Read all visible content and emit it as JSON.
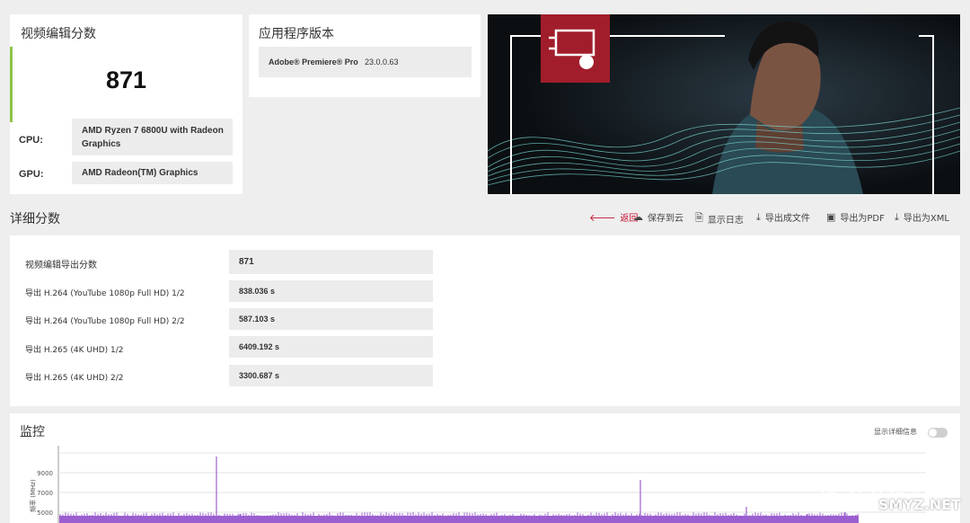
{
  "score_card": {
    "title": "视频编辑分数",
    "score": "871",
    "cpu_label": "CPU:",
    "cpu_value": "AMD Ryzen 7 6800U with Radeon Graphics",
    "gpu_label": "GPU:",
    "gpu_value": "AMD Radeon(TM) Graphics"
  },
  "version_card": {
    "title": "应用程序版本",
    "app_name": "Adobe® Premiere® Pro",
    "app_version": "23.0.0.63"
  },
  "details": {
    "title": "详细分数",
    "toolbar": {
      "back": "返回",
      "save_cloud": "保存到云",
      "show_log": "显示日志",
      "export_file": "导出成文件",
      "export_pdf": "导出为PDF",
      "export_xml": "导出为XML"
    },
    "rows": [
      {
        "label": "视频编辑导出分数",
        "value": "871"
      },
      {
        "label": "导出 H.264 (YouTube 1080p Full HD) 1/2",
        "value": "838.036 s"
      },
      {
        "label": "导出 H.264 (YouTube 1080p Full HD) 2/2",
        "value": "587.103 s"
      },
      {
        "label": "导出 H.265 (4K UHD) 1/2",
        "value": "6409.192 s"
      },
      {
        "label": "导出 H.265 (4K UHD) 2/2",
        "value": "3300.687 s"
      }
    ]
  },
  "monitor": {
    "title": "监控",
    "show_details_label": "显示详细信息",
    "y_axis_label": "频率 (MHz)",
    "y_ticks": [
      "9000",
      "7000",
      "5000"
    ]
  },
  "watermark": {
    "text": "值 什么值得买",
    "site": "SMYZ.NET"
  },
  "colors": {
    "accent_green": "#8ec449",
    "brand_red": "#a11d2b",
    "chart_purple": "#9b5fd0",
    "back_red": "#c8102e"
  }
}
